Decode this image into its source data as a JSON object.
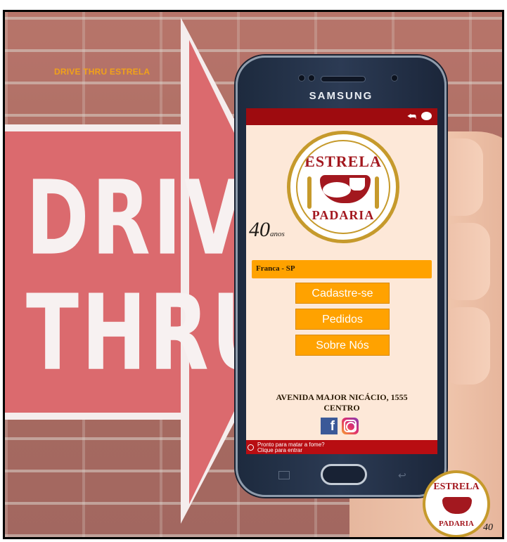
{
  "app_label": "DRIVE THRU ESTRELA",
  "sign": {
    "line1": "DRIVE",
    "line2": "THRU"
  },
  "phone": {
    "brand": "SAMSUNG",
    "app": {
      "logo": {
        "top_text": "ESTRELA",
        "bottom_text": "PADARIA"
      },
      "anniversary": {
        "number": "40",
        "suffix": "anos"
      },
      "city": "Franca - SP",
      "menu": [
        {
          "label": "Cadastre-se"
        },
        {
          "label": "Pedidos"
        },
        {
          "label": "Sobre Nós"
        }
      ],
      "address": {
        "line1": "AVENIDA MAJOR NICÁCIO, 1555",
        "line2": "CENTRO"
      },
      "social": {
        "facebook_glyph": "f"
      },
      "notification": {
        "title": "Pronto para matar a fome?",
        "subtitle": "Clique para entrar"
      }
    }
  },
  "corner_logo": {
    "top_text": "ESTRELA",
    "bottom_text": "PADARIA",
    "mark": "40"
  },
  "colors": {
    "accent": "#ffa200",
    "top_bar": "#9e0b0f",
    "brand_red": "#a3181f",
    "gold": "#c69a2c",
    "screen_bg": "#fde8d8"
  },
  "icons": [
    "share-icon",
    "chat-icon",
    "facebook-icon",
    "instagram-icon",
    "home-button",
    "recent-apps-icon",
    "back-icon"
  ]
}
